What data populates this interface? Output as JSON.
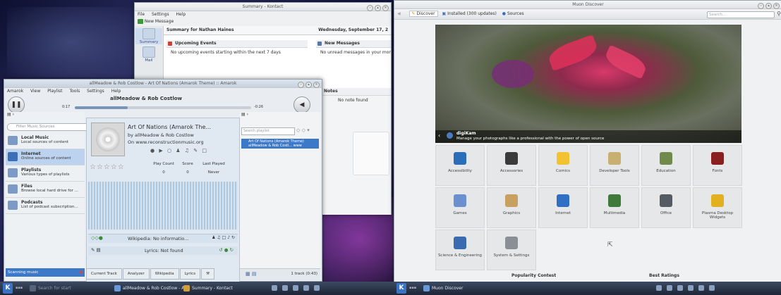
{
  "kontact": {
    "title": "Summary - Kontact",
    "menu": [
      "File",
      "Settings",
      "Help"
    ],
    "toolbar_new": "New Message",
    "sidebar": [
      "Summary",
      "Mail"
    ],
    "summary_for": "Summary for Nathan Haines",
    "date": "Wednesday, September 17, 2",
    "upcoming_events_title": "Upcoming Events",
    "upcoming_events_text": "No upcoming events starting within the next 7 days",
    "new_messages_title": "New Messages",
    "new_messages_text": "No unread messages in your monitored folders",
    "notes_title": "Notes",
    "notes_text": "No note found"
  },
  "amarok": {
    "title": "allMeadow & Rob Costlow - Art Of Nations (Amarok Theme) :: Amarok",
    "menu": [
      "Amarok",
      "View",
      "Playlist",
      "Tools",
      "Settings",
      "Help"
    ],
    "artist_line": "allMeadow & Rob Costlow",
    "time_elapsed": "0:17",
    "time_remaining": "-0:26",
    "progress": 0.3,
    "filter_placeholder": "Filter Music Sources",
    "sources": [
      {
        "name": "Local Music",
        "desc": "Local sources of content"
      },
      {
        "name": "Internet",
        "desc": "Online sources of content"
      },
      {
        "name": "Playlists",
        "desc": "Various types of playlists"
      },
      {
        "name": "Files",
        "desc": "Browse local hard drive for ..."
      },
      {
        "name": "Podcasts",
        "desc": "List of podcast subscription..."
      }
    ],
    "track_title": "Art Of Nations (Amarok The...",
    "track_by": "by allMeadow & Rob Costlow",
    "track_on": "On www.reconstructionmusic.org",
    "stats_headers": [
      "Play Count",
      "Score",
      "Last Played"
    ],
    "stats_values": [
      "0",
      "0",
      "Never"
    ],
    "wikipedia": "Wikipedia: No informatio...",
    "lyrics": "Lyrics: Not found",
    "search_playlist": "Search playlist",
    "playlist_item_1": "Art Of Nations (Amarok Theme)",
    "playlist_item_2": "allMeadow & Rob Costl... www",
    "tabs": [
      "Current Track",
      "Analyzer",
      "Wikipedia",
      "Lyrics"
    ],
    "track_count": "1 track (0:43)",
    "status": "Scanning music"
  },
  "muon": {
    "title": "Muon Discover",
    "tabs": [
      "Discover",
      "Installed (300 updates)",
      "Sources"
    ],
    "search_placeholder": "Search...",
    "banner_app": "digiKam",
    "banner_desc": "Manage your photographs like a professional with the power of open source",
    "categories": [
      {
        "label": "Accessibility",
        "color": "#2a6db8"
      },
      {
        "label": "Accessories",
        "color": "#3a3a3a"
      },
      {
        "label": "Comics",
        "color": "#f2c230"
      },
      {
        "label": "Developer Tools",
        "color": "#c9b070"
      },
      {
        "label": "Education",
        "color": "#6f8a4a"
      },
      {
        "label": "Fonts",
        "color": "#8a1f1f"
      },
      {
        "label": "Games",
        "color": "#6a90d0"
      },
      {
        "label": "Graphics",
        "color": "#c8a060"
      },
      {
        "label": "Internet",
        "color": "#2f6fc4"
      },
      {
        "label": "Multimedia",
        "color": "#3f7a3a"
      },
      {
        "label": "Office",
        "color": "#555b63"
      },
      {
        "label": "Plasma Desktop Widgets",
        "color": "#e3b020"
      },
      {
        "label": "Science & Engineering",
        "color": "#3a6ab0"
      },
      {
        "label": "System & Settings",
        "color": "#8a8f96"
      }
    ],
    "popularity": "Popularity Contest",
    "best_ratings": "Best Ratings"
  },
  "taskbar": {
    "left_search": "Search for start",
    "tasks": [
      "allMeadow & Rob Costlow - Art",
      "Summary - Kontact"
    ],
    "right_task": "Muon Discover"
  }
}
